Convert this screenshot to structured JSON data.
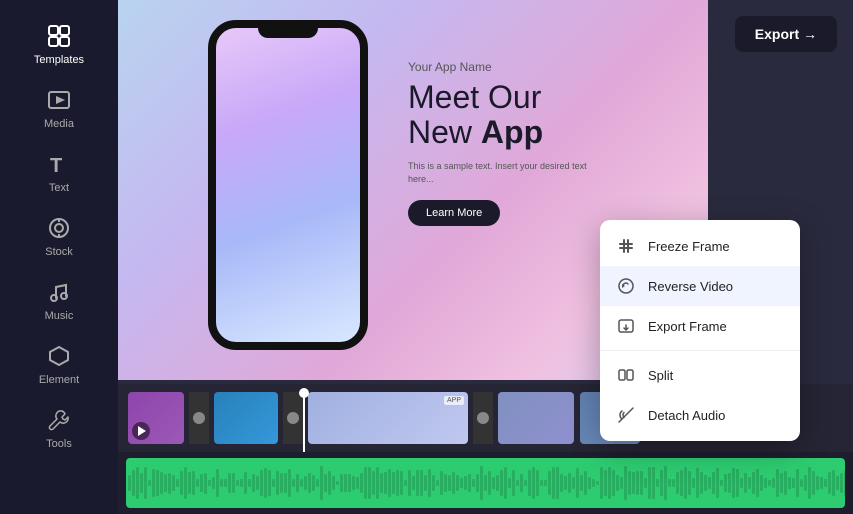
{
  "sidebar": {
    "items": [
      {
        "id": "templates",
        "label": "Templates",
        "active": true
      },
      {
        "id": "media",
        "label": "Media",
        "active": false
      },
      {
        "id": "text",
        "label": "Text",
        "active": false
      },
      {
        "id": "stock",
        "label": "Stock",
        "active": false
      },
      {
        "id": "music",
        "label": "Music",
        "active": false
      },
      {
        "id": "element",
        "label": "Element",
        "active": false
      },
      {
        "id": "tools",
        "label": "Tools",
        "active": false
      }
    ]
  },
  "header": {
    "export_label": "Export →"
  },
  "preview": {
    "app_name": "Your App Name",
    "headline_line1": "Meet Our",
    "headline_line2": "New App",
    "body_text": "This is a sample text. Insert your desired text here...",
    "cta_label": "Learn More"
  },
  "context_menu": {
    "items": [
      {
        "id": "freeze-frame",
        "label": "Freeze Frame",
        "icon": "freeze"
      },
      {
        "id": "reverse-video",
        "label": "Reverse Video",
        "icon": "reverse",
        "active": true
      },
      {
        "id": "export-frame",
        "label": "Export Frame",
        "icon": "export-frame"
      },
      {
        "separator": true
      },
      {
        "id": "split",
        "label": "Split",
        "icon": "split"
      },
      {
        "id": "detach-audio",
        "label": "Detach Audio",
        "icon": "detach"
      }
    ]
  },
  "colors": {
    "accent": "#1a1a2a",
    "sidebar_bg": "#1a1a2e",
    "menu_bg": "#ffffff",
    "active_menu_bg": "#f0f4ff",
    "waveform": "#2ecc71"
  }
}
